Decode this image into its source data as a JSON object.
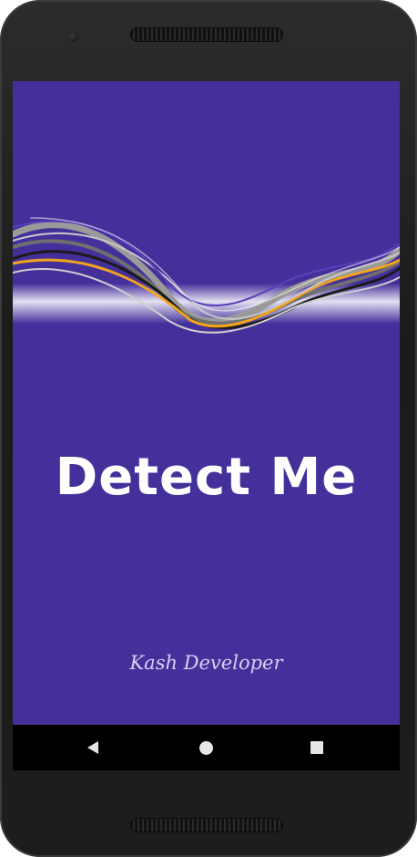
{
  "app": {
    "title": "Detect Me",
    "credit": "Kash Developer"
  },
  "colors": {
    "background": "#45309b",
    "title_text": "#ffffff",
    "credit_text": "#d8cff0",
    "wave_accent": "#f2a51c",
    "navbar": "#000000"
  },
  "navigation": {
    "back_icon": "back-triangle-icon",
    "home_icon": "home-circle-icon",
    "recents_icon": "recents-square-icon"
  }
}
